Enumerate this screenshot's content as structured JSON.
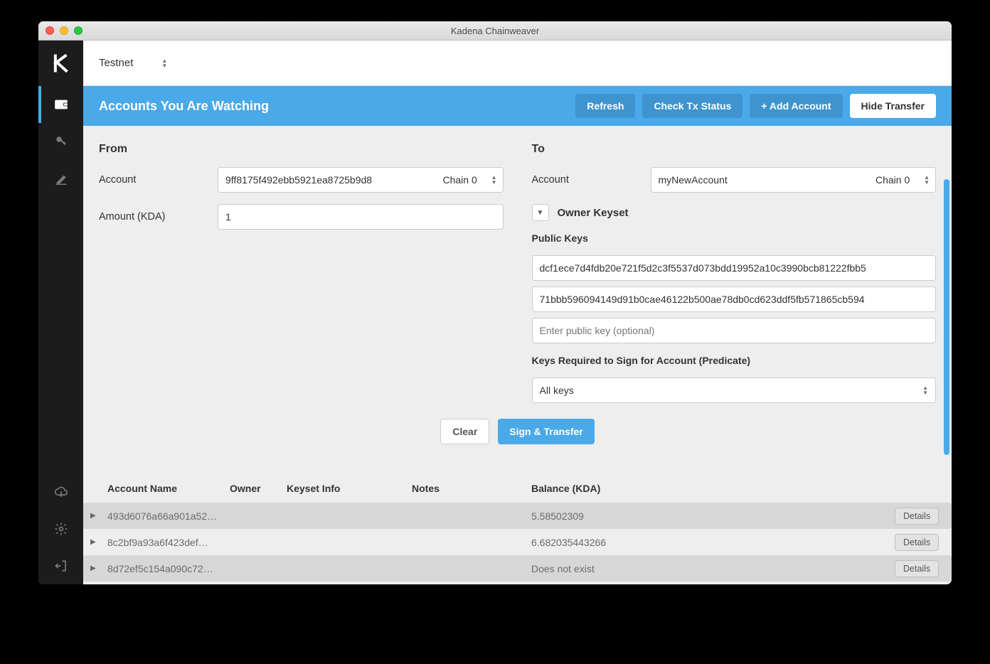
{
  "window": {
    "title": "Kadena Chainweaver"
  },
  "topbar": {
    "network": "Testnet"
  },
  "header": {
    "title": "Accounts You Are Watching",
    "refresh": "Refresh",
    "check_tx": "Check Tx Status",
    "add_account": "+ Add Account",
    "hide_transfer": "Hide Transfer"
  },
  "from": {
    "label": "From",
    "account_label": "Account",
    "account_value": "9ff8175f492ebb5921ea8725b9d8",
    "chain": "Chain 0",
    "amount_label": "Amount (KDA)",
    "amount_value": "1"
  },
  "to": {
    "label": "To",
    "account_label": "Account",
    "account_value": "myNewAccount",
    "chain": "Chain 0",
    "keyset_title": "Owner Keyset",
    "pubkeys_label": "Public Keys",
    "key1": "dcf1ece7d4fdb20e721f5d2c3f5537d073bdd19952a10c3990bcb81222fbb5",
    "key2": "71bbb596094149d91b0cae46122b500ae78db0cd623ddf5fb571865cb594",
    "key_placeholder": "Enter public key (optional)",
    "predicate_label": "Keys Required to Sign for Account (Predicate)",
    "predicate_value": "All keys"
  },
  "actions": {
    "clear": "Clear",
    "sign": "Sign & Transfer"
  },
  "table": {
    "cols": {
      "acct": "Account Name",
      "owner": "Owner",
      "keyset": "Keyset Info",
      "notes": "Notes",
      "balance": "Balance (KDA)"
    },
    "details": "Details",
    "rows": [
      {
        "acct": "493d6076a66a901a52…",
        "balance": "5.58502309"
      },
      {
        "acct": "8c2bf9a93a6f423def…",
        "balance": "6.682035443266"
      },
      {
        "acct": "8d72ef5c154a090c72…",
        "balance": "Does not exist"
      }
    ]
  }
}
